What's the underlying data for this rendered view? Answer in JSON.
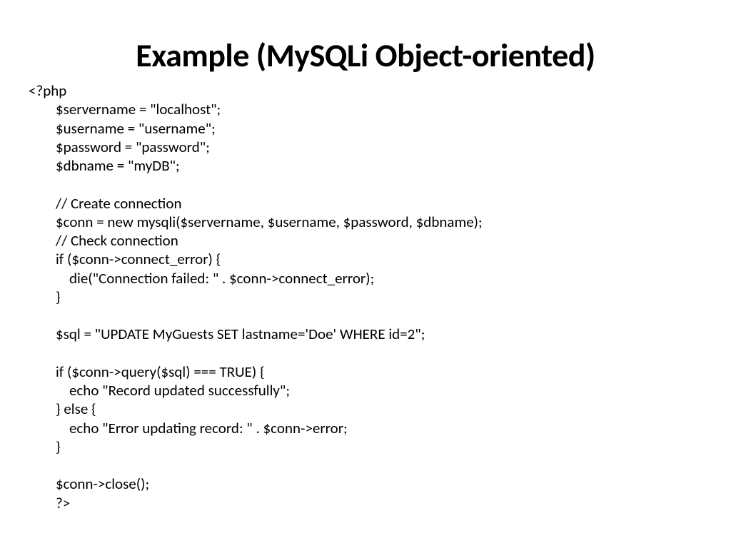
{
  "title": "Example (MySQLi Object-oriented)",
  "code": "<?php\n        $servername = \"localhost\";\n        $username = \"username\";\n        $password = \"password\";\n        $dbname = \"myDB\";\n\n        // Create connection\n        $conn = new mysqli($servername, $username, $password, $dbname);\n        // Check connection\n        if ($conn->connect_error) {\n            die(\"Connection failed: \" . $conn->connect_error);\n        } \n\n        $sql = \"UPDATE MyGuests SET lastname='Doe' WHERE id=2\";\n\n        if ($conn->query($sql) === TRUE) {\n            echo \"Record updated successfully\";\n        } else {\n            echo \"Error updating record: \" . $conn->error;\n        }\n\n        $conn->close();\n        ?>"
}
